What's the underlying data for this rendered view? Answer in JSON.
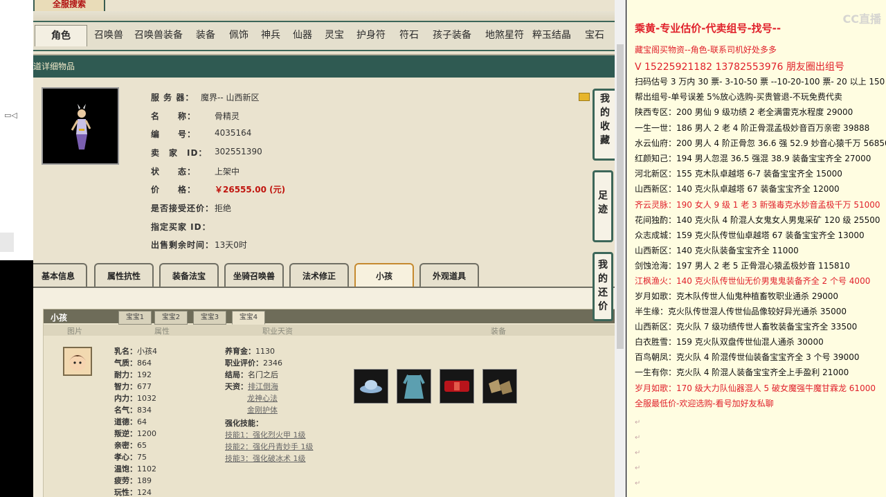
{
  "site_logo": "全服搜索",
  "nav_tabs": [
    "角色",
    "召唤兽",
    "召唤兽装备",
    "装备",
    "佩饰",
    "神兵",
    "仙器",
    "灵宝",
    "护身符",
    "符石",
    "孩子装备",
    "地煞星符",
    "粹玉结晶",
    "宝石"
  ],
  "detail_bar": "道详细物品",
  "item": {
    "server_label": "服 务 器：",
    "server_value": "魔界-- 山西新区",
    "name_label": "名　　称：",
    "name_value": "骨精灵",
    "id_label": "编　　号：",
    "id_value": "4035164",
    "seller_label": "卖　家　ID：",
    "seller_value": "302551390",
    "status_label": "状　　态：",
    "status_value": "上架中",
    "price_label": "价　　格：",
    "price_value": "￥26555.00 (元)",
    "bargain_label": "是否接受还价：",
    "bargain_value": "拒绝",
    "buyer_label": "指定买家 ID：",
    "buyer_value": "",
    "remaining_label": "出售剩余时间：",
    "remaining_value": "13天0时"
  },
  "sub_tabs": [
    "基本信息",
    "属性抗性",
    "装备法宝",
    "坐骑召唤兽",
    "法术修正",
    "小孩",
    "外观道具"
  ],
  "side_buttons": [
    "我的收藏",
    "足迹",
    "我的还价"
  ],
  "kid": {
    "title": "小孩",
    "tabs": [
      "宝宝1",
      "宝宝2",
      "宝宝3",
      "宝宝4"
    ],
    "columns": [
      "图片",
      "属性",
      "职业天资",
      "装备"
    ],
    "attrs": [
      [
        "乳名：",
        "小孩4"
      ],
      [
        "气质：",
        "864"
      ],
      [
        "耐力：",
        "192"
      ],
      [
        "智力：",
        "677"
      ],
      [
        "内力：",
        "1032"
      ],
      [
        "名气：",
        "834"
      ],
      [
        "道德：",
        "64"
      ],
      [
        "叛逆：",
        "1200"
      ],
      [
        "亲密：",
        "65"
      ],
      [
        "孝心：",
        "75"
      ],
      [
        "温饱：",
        "1102"
      ],
      [
        "疲劳：",
        "189"
      ],
      [
        "玩性：",
        "124"
      ]
    ],
    "nurture_label": "养育金：",
    "nurture_value": "1130",
    "career_label": "职业评价：",
    "career_value": "2346",
    "ending_label": "结局：",
    "ending_value": "名门之后",
    "talent_label": "天资：",
    "talents": [
      "排江倒海",
      "龙神心法",
      "金刚护体"
    ],
    "skills_label": "强化技能：",
    "skills": [
      "技能1：强化烈火甲 1级",
      "技能2：强化丹青妙手 1级",
      "技能3：强化破冰术 1级"
    ]
  },
  "doc_watermark": "CC直播",
  "doc_lines": [
    {
      "text": "乘黄-专业估价-代卖组号-找号--",
      "style": "big"
    },
    {
      "text": "藏宝阁买物资--角色-联系司机好处多多",
      "style": "red"
    },
    {
      "text": "V 15225921182   13782553976 朋友圈出组号",
      "style": "mid"
    },
    {
      "text": "扫码估号 3 万内 30 票- 3-10-50 票  --10-20-100 票- 20 以上 150",
      "style": ""
    },
    {
      "text": "帮出组号-单号误差 5%放心选购-买贵管退-不玩免费代卖",
      "style": ""
    },
    {
      "text": "陕西专区：200 男仙 9 级功绩 2 老全满雷克水程度 29000",
      "style": ""
    },
    {
      "text": "一生一世：186 男人 2 老 4 阶正骨混孟极妙音百万亲密 39888",
      "style": ""
    },
    {
      "text": "水云仙府：200 男人 4 阶正骨忽 36.6 强 52.9 妙音心猿千万 56850",
      "style": ""
    },
    {
      "text": "红颜知己：194 男人忽混 36.5 强混 38.9 装备宝宝齐全 27000",
      "style": ""
    },
    {
      "text": "河北新区：155 克木队卓越塔 6-7 装备宝宝齐全 15000",
      "style": ""
    },
    {
      "text": "山西新区：140 克火队卓越塔 67 装备宝宝齐全 12000",
      "style": ""
    },
    {
      "text": "齐云灵脉：190 女人 9 级 1 老 3 新强毒克水妙音孟极千万 51000",
      "style": "red"
    },
    {
      "text": "花间独酌：140 克火队 4 阶混人女鬼女人男鬼采矿 120 级 25500",
      "style": ""
    },
    {
      "text": "众志成城：159 克火队传世仙卓越塔 67 装备宝宝齐全 13000",
      "style": ""
    },
    {
      "text": "山西新区：140 克火队装备宝宝齐全 11000",
      "style": ""
    },
    {
      "text": "剑蚀沧海：197 男人 2 老 5 正骨混心猿孟极妙音 115810",
      "style": ""
    },
    {
      "text": "江枫渔火：140 克火队传世仙无价男鬼鬼装备齐全 2 个号 4000",
      "style": "red"
    },
    {
      "text": "岁月如歌：克木队传世人仙鬼种植畜牧职业通杀 29000",
      "style": ""
    },
    {
      "text": "半生缘：克火队传世混人传世仙品像较好异光通杀 35000",
      "style": ""
    },
    {
      "text": "山西新区：克火队 7 级功绩传世人畜牧装备宝宝齐全 33500",
      "style": ""
    },
    {
      "text": "白衣胜雪：159 克火队双盘传世仙混人通杀 30000",
      "style": ""
    },
    {
      "text": "百鸟朝凤：克火队 4 阶混传世仙装备宝宝齐全 3 个号 39000",
      "style": ""
    },
    {
      "text": "一生有你：克火队 4 阶混人装备宝宝齐全上手盈利 21000",
      "style": ""
    },
    {
      "text": "岁月如歌：170 级大力队仙器混人 5 破女魔强牛魔甘霖龙 61000",
      "style": "red"
    },
    {
      "text": "全服最低价-欢迎选购-看号加好友私聊",
      "style": "red"
    }
  ]
}
